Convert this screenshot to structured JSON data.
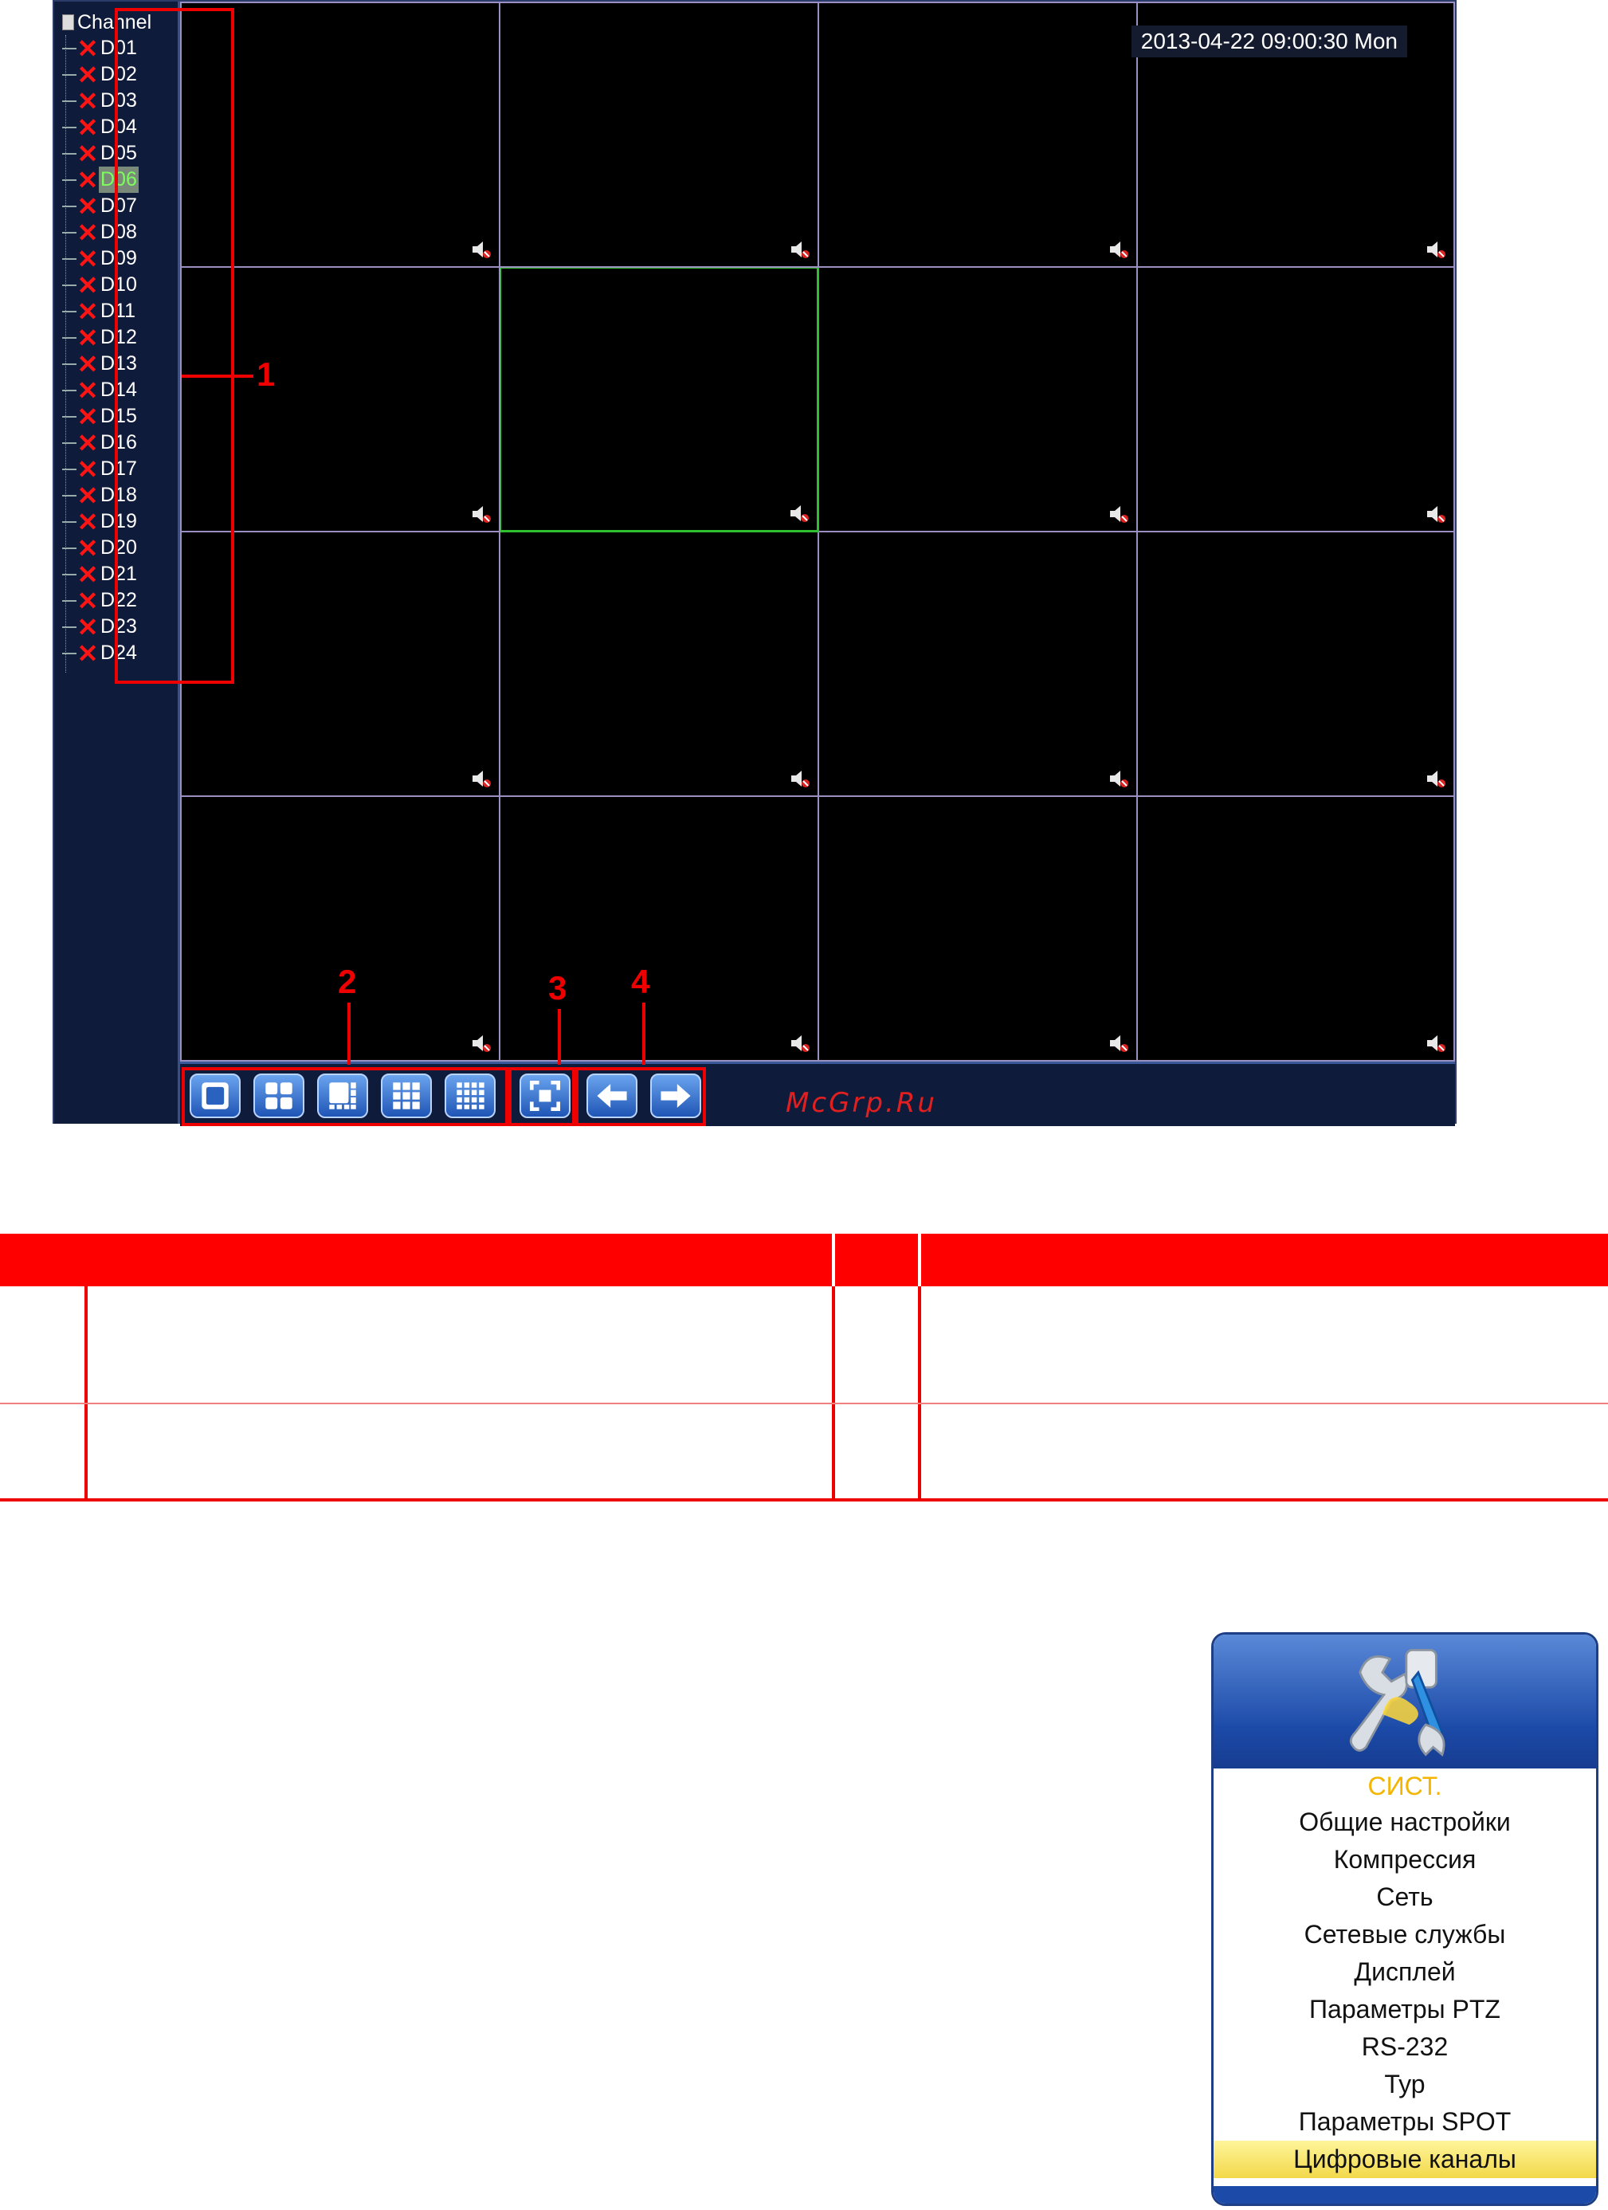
{
  "dvr": {
    "datetime": "2013-04-22 09:00:30 Mon",
    "tree_header": "Channel",
    "channels": [
      "D01",
      "D02",
      "D03",
      "D04",
      "D05",
      "D06",
      "D07",
      "D08",
      "D09",
      "D10",
      "D11",
      "D12",
      "D13",
      "D14",
      "D15",
      "D16",
      "D17",
      "D18",
      "D19",
      "D20",
      "D21",
      "D22",
      "D23",
      "D24"
    ],
    "selected_channel": "D06",
    "toolbar": {
      "layout_buttons": [
        "single-view-icon",
        "quad-view-icon",
        "eight-view-icon",
        "nine-view-icon",
        "sixteen-view-icon"
      ],
      "fullscreen": "fullscreen-icon",
      "prev": "arrow-left-icon",
      "next": "arrow-right-icon"
    },
    "watermark": "McGrp.Ru"
  },
  "callouts": [
    "1",
    "2",
    "3",
    "4"
  ],
  "menu": {
    "title": "СИСТ.",
    "items": [
      "Общие настройки",
      "Компрессия",
      "Сеть",
      "Сетевые службы",
      "Дисплей",
      "Параметры PTZ",
      "RS-232",
      "Тур",
      "Параметры SPOT",
      "Цифровые каналы"
    ],
    "highlighted": "Цифровые каналы"
  },
  "colors": {
    "accent_red": "#ff0000",
    "active_cell": "#2fbf2f",
    "menu_title": "#f4b400"
  }
}
